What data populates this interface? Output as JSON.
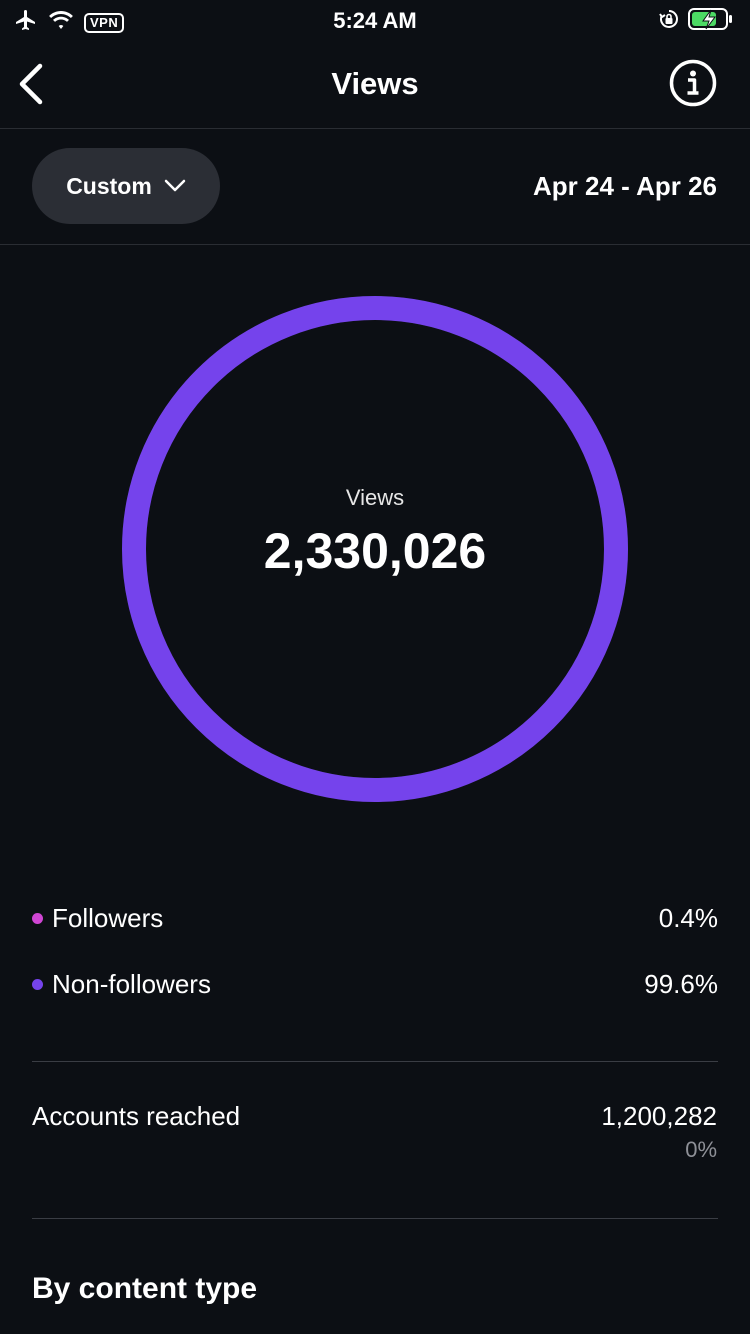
{
  "status_bar": {
    "vpn_label": "VPN",
    "time": "5:24 AM",
    "icons": [
      "airplane-icon",
      "wifi-icon",
      "orientation-lock-icon",
      "battery-charging-icon"
    ]
  },
  "nav": {
    "title": "Views",
    "back_icon": "chevron-left-icon",
    "info_icon": "info-icon"
  },
  "filter": {
    "range_label": "Custom",
    "date_range": "Apr 24 - Apr 26"
  },
  "summary": {
    "label": "Views",
    "value": "2,330,026",
    "ring_color": "#7543ec",
    "ring_fraction": 1.0
  },
  "breakdown": [
    {
      "label": "Followers",
      "value": "0.4%",
      "color": "#d046d4"
    },
    {
      "label": "Non-followers",
      "value": "99.6%",
      "color": "#7543ec"
    }
  ],
  "accounts_reached": {
    "label": "Accounts reached",
    "value": "1,200,282",
    "change": "0%"
  },
  "section": {
    "title": "By content type"
  }
}
